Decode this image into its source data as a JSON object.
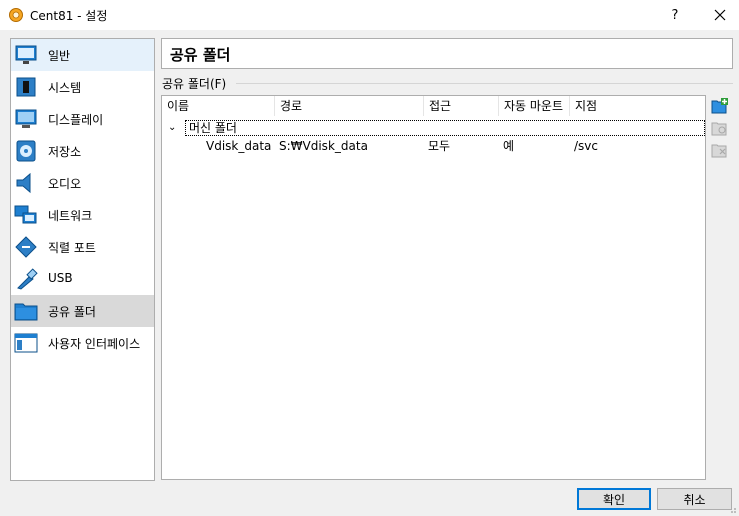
{
  "window": {
    "title": "Cent81 - 설정",
    "help_label": "?",
    "close_label": "✕"
  },
  "sidebar": {
    "items": [
      {
        "label": "일반",
        "icon": "general-icon"
      },
      {
        "label": "시스템",
        "icon": "system-icon"
      },
      {
        "label": "디스플레이",
        "icon": "display-icon"
      },
      {
        "label": "저장소",
        "icon": "storage-icon"
      },
      {
        "label": "오디오",
        "icon": "audio-icon"
      },
      {
        "label": "네트워크",
        "icon": "network-icon"
      },
      {
        "label": "직렬 포트",
        "icon": "serial-port-icon"
      },
      {
        "label": "USB",
        "icon": "usb-icon"
      },
      {
        "label": "공유 폴더",
        "icon": "shared-folder-icon",
        "selected": true
      },
      {
        "label": "사용자 인터페이스",
        "icon": "user-interface-icon"
      }
    ]
  },
  "main": {
    "header_title": "공유 폴더",
    "group_label": "공유 폴더(F)",
    "table": {
      "columns": [
        "이름",
        "경로",
        "접근",
        "자동 마운트",
        "지점"
      ],
      "group": {
        "expander": "⌄",
        "label": "머신 폴더"
      },
      "rows": [
        {
          "name": "Vdisk_data",
          "path": "S:₩Vdisk_data",
          "access": "모두",
          "automount": "예",
          "mount_point": "/svc"
        }
      ]
    },
    "tools": [
      "add-folder-icon",
      "edit-folder-icon",
      "remove-folder-icon"
    ]
  },
  "footer": {
    "ok_label": "확인",
    "cancel_label": "취소"
  }
}
